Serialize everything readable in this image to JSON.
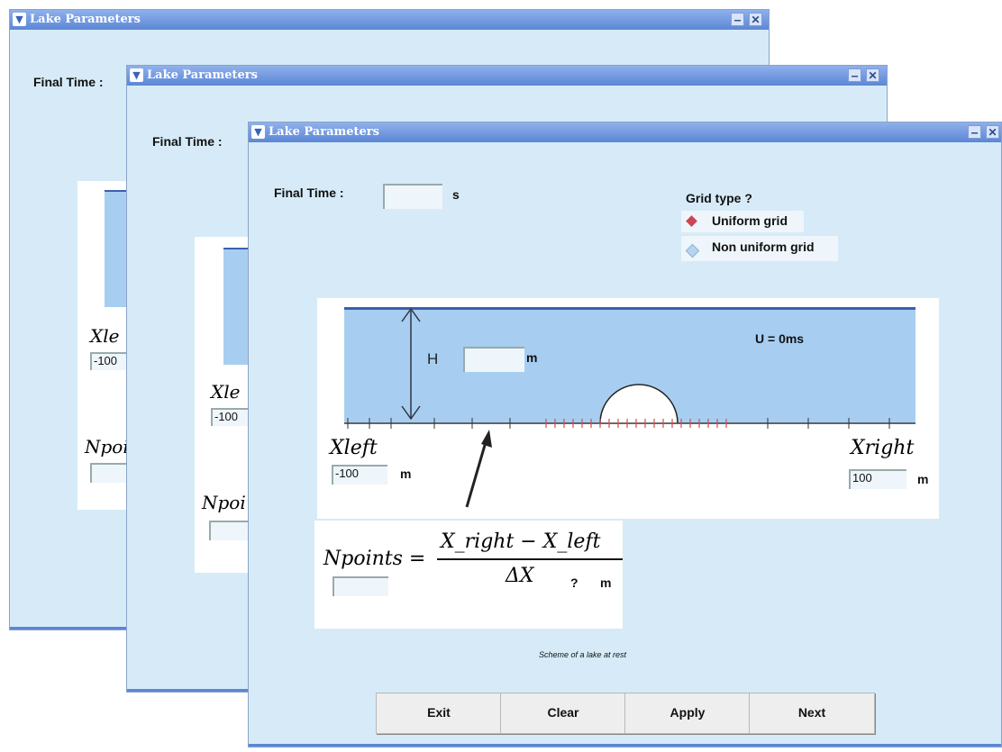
{
  "window_title": "Lake Parameters",
  "titlebar": {
    "menu_glyph": "▼",
    "minimize_glyph": "‒",
    "close_glyph": "✕"
  },
  "form": {
    "final_time_label": "Final Time :",
    "final_time_value": "",
    "final_time_unit": "s",
    "grid_type_label": "Grid type ?",
    "grid_options": [
      {
        "label": "Uniform grid",
        "selected": true
      },
      {
        "label": "Non uniform grid",
        "selected": false
      }
    ]
  },
  "scheme": {
    "h_label": "H",
    "h_value": "",
    "h_unit": "m",
    "velocity_label": "U = 0ms",
    "xleft_label": "Xleft",
    "xleft_value": "-100",
    "xleft_unit": "m",
    "xright_label": "Xright",
    "xright_value": "100",
    "xright_unit": "m",
    "caption": "Scheme of a lake at rest"
  },
  "formula": {
    "lhs": "Npoints =",
    "numerator": "X_right − X_left",
    "denominator": "ΔX",
    "dx_value": "?",
    "dx_unit": "m",
    "npoints_value": ""
  },
  "back_windows": {
    "xleft_partial": "Xle",
    "npoints_partial": "Npoi",
    "xleft_value": "-100"
  },
  "buttons": {
    "exit": "Exit",
    "clear": "Clear",
    "apply": "Apply",
    "next": "Next"
  },
  "colors": {
    "title_gradient_top": "#8fb1ec",
    "title_gradient_bottom": "#5c86d6",
    "water": "#a7cef0",
    "grid_red": "#e0474c",
    "radio_selected": "#cc4455"
  }
}
